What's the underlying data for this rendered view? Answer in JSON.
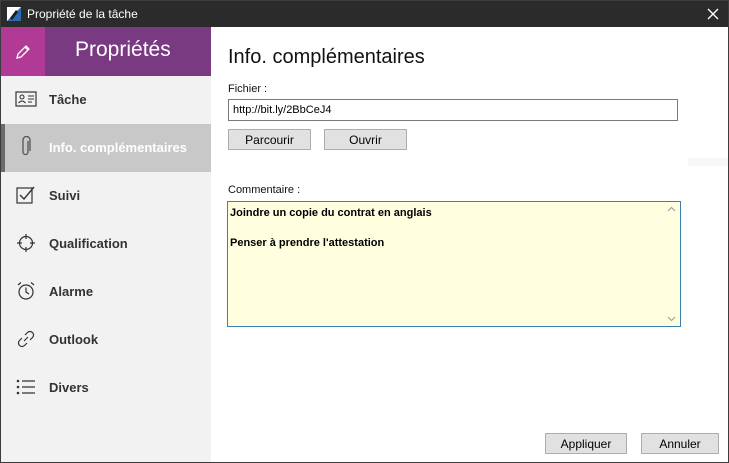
{
  "window": {
    "title": "Propriété de la tâche"
  },
  "sidebar": {
    "header_title": "Propriétés",
    "items": [
      {
        "label": "Tâche",
        "icon": "id-card-icon",
        "active": false
      },
      {
        "label": "Info. complémentaires",
        "icon": "paperclip-icon",
        "active": true
      },
      {
        "label": "Suivi",
        "icon": "checkbox-icon",
        "active": false
      },
      {
        "label": "Qualification",
        "icon": "crosshair-icon",
        "active": false
      },
      {
        "label": "Alarme",
        "icon": "alarm-clock-icon",
        "active": false
      },
      {
        "label": "Outlook",
        "icon": "link-icon",
        "active": false
      },
      {
        "label": "Divers",
        "icon": "list-icon",
        "active": false
      }
    ]
  },
  "main": {
    "title": "Info. complémentaires",
    "fichier_label": "Fichier :",
    "fichier_value": "http://bit.ly/2BbCeJ4",
    "parcourir_label": "Parcourir",
    "ouvrir_label": "Ouvrir",
    "commentaire_label": "Commentaire :",
    "commentaire_value": "Joindre un copie du contrat en anglais\n\nPenser à prendre l'attestation",
    "appliquer_label": "Appliquer",
    "annuler_label": "Annuler"
  },
  "colors": {
    "accent_magenta": "#b03a96",
    "header_purple": "#7a3a82",
    "comment_bg": "#ffffe0",
    "comment_border": "#3c7fb1"
  }
}
